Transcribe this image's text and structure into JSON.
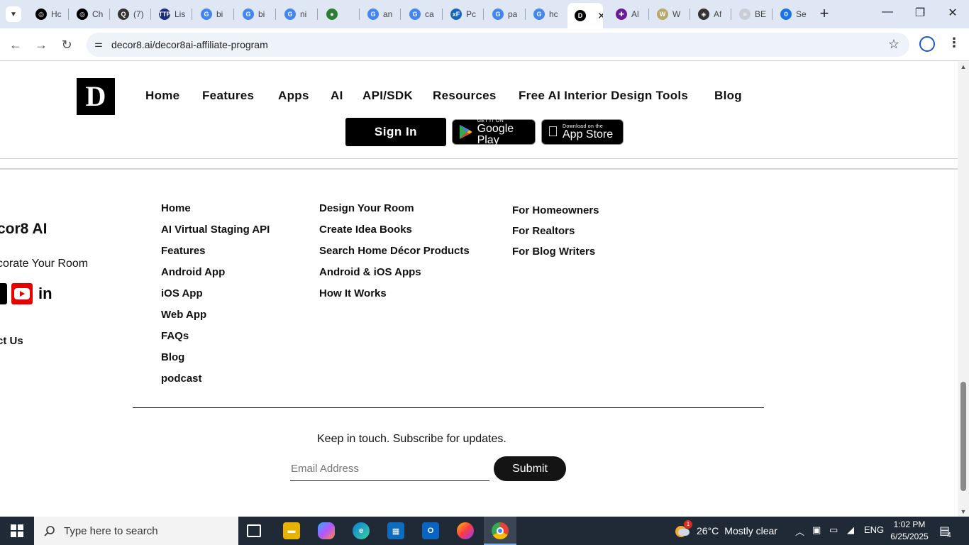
{
  "browser": {
    "tabs": [
      {
        "label": "Hc",
        "color": "#000000",
        "glyph": "◎"
      },
      {
        "label": "Ch",
        "color": "#000000",
        "glyph": "◎"
      },
      {
        "label": "(7)",
        "color": "#333333",
        "glyph": "Q"
      },
      {
        "label": "Lis",
        "color": "#1b2f7a",
        "glyph": "TTP"
      },
      {
        "label": "bi",
        "color": "#4285f4",
        "glyph": "G"
      },
      {
        "label": "bi",
        "color": "#4285f4",
        "glyph": "G"
      },
      {
        "label": "ni",
        "color": "#4285f4",
        "glyph": "G"
      },
      {
        "label": "",
        "color": "#2e7d32",
        "glyph": "●"
      },
      {
        "label": "an",
        "color": "#4285f4",
        "glyph": "G"
      },
      {
        "label": "ca",
        "color": "#4285f4",
        "glyph": "G"
      },
      {
        "label": "Pc",
        "color": "#1565c0",
        "glyph": "xF"
      },
      {
        "label": "pa",
        "color": "#4285f4",
        "glyph": "G"
      },
      {
        "label": "hc",
        "color": "#4285f4",
        "glyph": "G"
      },
      {
        "label": "",
        "color": "#000000",
        "glyph": "D",
        "active": true
      },
      {
        "label": "Al",
        "color": "#6a1b9a",
        "glyph": "✚"
      },
      {
        "label": "W",
        "color": "#b8a76a",
        "glyph": "W"
      },
      {
        "label": "Af",
        "color": "#333333",
        "glyph": "◈"
      },
      {
        "label": "BE",
        "color": "#c9cdd6",
        "glyph": "≡"
      },
      {
        "label": "Se",
        "color": "#1a73e8",
        "glyph": "⚙"
      }
    ],
    "url": "decor8.ai/decor8ai-affiliate-program"
  },
  "site": {
    "logo_letter": "D",
    "nav": [
      "Home",
      "Features",
      "Apps",
      "AI",
      "API/SDK",
      "Resources",
      "Free AI Interior Design Tools",
      "Blog"
    ],
    "signin": "Sign In",
    "google_play": {
      "small": "GET IT ON",
      "big": "Google Play"
    },
    "app_store": {
      "small": "Download on the",
      "big": "App Store"
    }
  },
  "footer": {
    "brand_name": "cor8 AI",
    "tagline": "corate Your Room",
    "contact": "ct Us",
    "col1": [
      "Home",
      "AI Virtual Staging API",
      "Features",
      "Android App",
      "iOS App",
      "Web App",
      "FAQs",
      "Blog",
      "podcast"
    ],
    "col2": [
      "Design Your Room",
      "Create Idea Books",
      "Search Home Décor Products",
      "Android & iOS Apps",
      "How It Works"
    ],
    "col3": [
      "For Homeowners",
      "For Realtors",
      "For Blog Writers"
    ],
    "subscribe_text": "Keep in touch. Subscribe for updates.",
    "email_placeholder": "Email Address",
    "submit": "Submit"
  },
  "taskbar": {
    "search_placeholder": "Type here to search",
    "weather_temp": "26°C",
    "weather_desc": "Mostly clear",
    "lang": "ENG",
    "time": "1:02 PM",
    "date": "6/25/2025",
    "notifications": "4",
    "weather_badge": "1"
  }
}
